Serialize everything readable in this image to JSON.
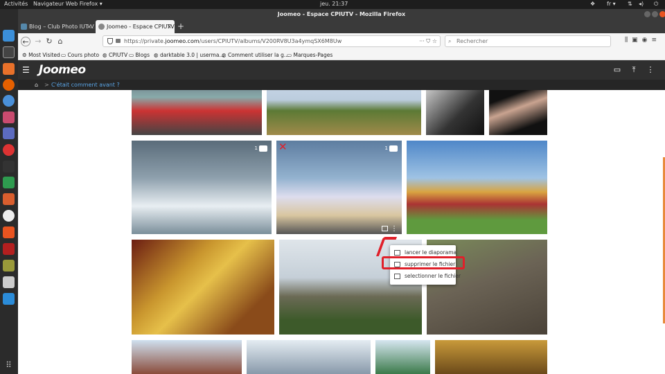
{
  "system_bar": {
    "activities": "Activités",
    "app_menu": "Navigateur Web Firefox ▾",
    "clock": "jeu. 21:37",
    "lang": "fr ▾"
  },
  "window": {
    "title": "Joomeo - Espace CPIUTV - Mozilla Firefox"
  },
  "tabs": [
    {
      "label": "Blog – Club Photo IUT V...",
      "close": "×"
    },
    {
      "label": "Joomeo - Espace CPIUTV",
      "close": "×"
    }
  ],
  "newtab": "+",
  "nav": {
    "url_prefix": "https://private.",
    "url_host": "joomeo.com",
    "url_path": "/users/CPIUTV/albums/V200RV8U3a4ymqSX6M8Uw",
    "url_actions": "··· ⛉ ☆",
    "search_placeholder": "Rechercher"
  },
  "bookmarks": [
    {
      "label": "Most Visited",
      "icon": "gear-icon"
    },
    {
      "label": "Cours photo",
      "icon": "folder-icon"
    },
    {
      "label": "CPIUTV",
      "icon": "globe-icon"
    },
    {
      "label": "Blogs",
      "icon": "folder-icon"
    },
    {
      "label": "darktable 3.0 | userma...",
      "icon": "globe-icon"
    },
    {
      "label": "Comment utiliser la g...",
      "icon": "globe-icon"
    },
    {
      "label": "Marques-Pages",
      "icon": "folder-icon"
    }
  ],
  "joomeo": {
    "logo": "Joomeo",
    "breadcrumb_sep": ">",
    "breadcrumb_link": "C'était comment avant ?"
  },
  "photos": {
    "comment_count_1": "1",
    "comment_count_2": "1"
  },
  "context_menu": [
    {
      "label": "lancer le diaporama",
      "icon": "slideshow-icon"
    },
    {
      "label": "supprimer le fichier",
      "icon": "trash-icon"
    },
    {
      "label": "selectionner le fichier",
      "icon": "select-icon"
    }
  ],
  "colors": {
    "accent_red": "#e0202a",
    "link_blue": "#5aa5e6",
    "header_dark": "#2f2f2f"
  }
}
